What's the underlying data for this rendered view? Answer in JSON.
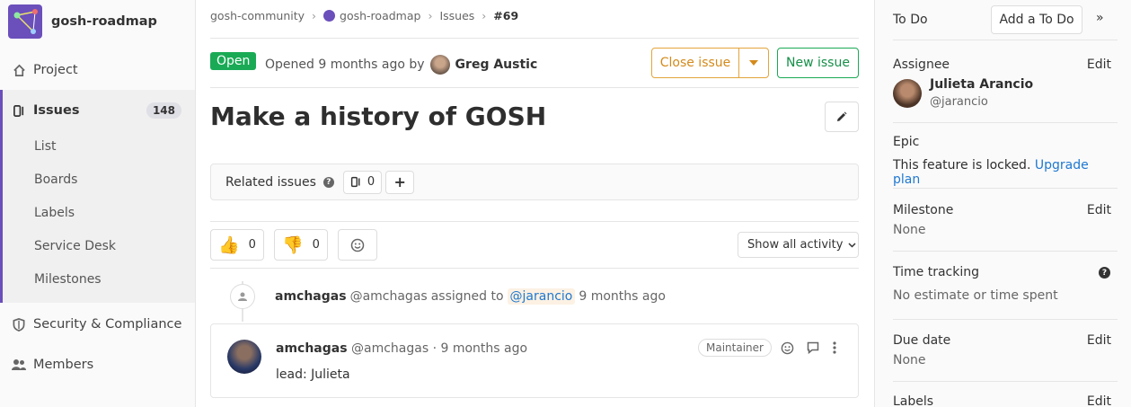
{
  "project": {
    "name": "gosh-roadmap"
  },
  "nav": {
    "project": "Project",
    "issues": "Issues",
    "issues_count": "148",
    "sub": [
      "List",
      "Boards",
      "Labels",
      "Service Desk",
      "Milestones"
    ],
    "security": "Security & Compliance",
    "members": "Members"
  },
  "breadcrumb": [
    "gosh-community",
    "gosh-roadmap",
    "Issues",
    "#69"
  ],
  "issue": {
    "status": "Open",
    "opened_text": "Opened 9 months ago by",
    "author": "Greg Austic",
    "title": "Make a history of GOSH",
    "close_label": "Close issue",
    "new_label": "New issue"
  },
  "related": {
    "label": "Related issues",
    "count": "0"
  },
  "awards": {
    "thumbsup": "0",
    "thumbsdown": "0"
  },
  "activity_filter": "Show all activity",
  "system_note": {
    "author": "amchagas",
    "handle": "@amchagas",
    "action": "assigned to",
    "mention": "@jarancio",
    "time": "9 months ago"
  },
  "comment": {
    "author": "amchagas",
    "meta": "@amchagas · 9 months ago",
    "role": "Maintainer",
    "body": "lead: Julieta"
  },
  "sidebar": {
    "todo_label": "To Do",
    "todo_button": "Add a To Do",
    "assignee_label": "Assignee",
    "edit": "Edit",
    "assignee_name": "Julieta Arancio",
    "assignee_handle": "@jarancio",
    "epic_label": "Epic",
    "epic_text": "This feature is locked.",
    "epic_link": "Upgrade plan",
    "milestone_label": "Milestone",
    "milestone_value": "None",
    "time_label": "Time tracking",
    "time_value": "No estimate or time spent",
    "due_label": "Due date",
    "due_value": "None",
    "labels_label": "Labels"
  },
  "colors": {
    "accent": "#6b4fbb",
    "open": "#1aaa55",
    "close": "#e3a53b",
    "link": "#1f78d1"
  }
}
